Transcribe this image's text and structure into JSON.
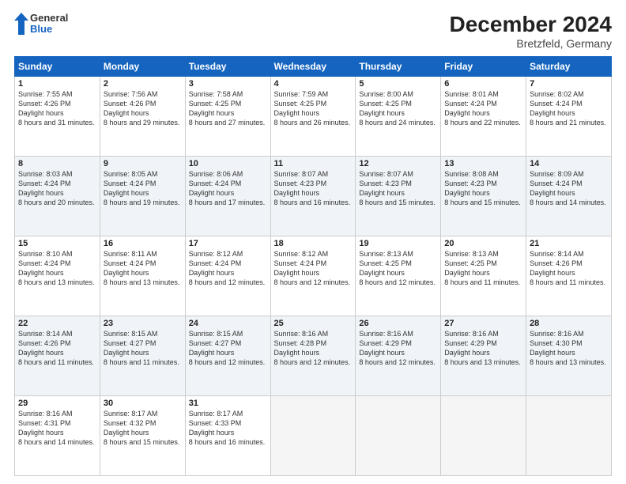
{
  "logo": {
    "general": "General",
    "blue": "Blue"
  },
  "title": "December 2024",
  "subtitle": "Bretzfeld, Germany",
  "days_of_week": [
    "Sunday",
    "Monday",
    "Tuesday",
    "Wednesday",
    "Thursday",
    "Friday",
    "Saturday"
  ],
  "weeks": [
    [
      {
        "day": "1",
        "sunrise": "7:55 AM",
        "sunset": "4:26 PM",
        "daylight": "8 hours and 31 minutes."
      },
      {
        "day": "2",
        "sunrise": "7:56 AM",
        "sunset": "4:26 PM",
        "daylight": "8 hours and 29 minutes."
      },
      {
        "day": "3",
        "sunrise": "7:58 AM",
        "sunset": "4:25 PM",
        "daylight": "8 hours and 27 minutes."
      },
      {
        "day": "4",
        "sunrise": "7:59 AM",
        "sunset": "4:25 PM",
        "daylight": "8 hours and 26 minutes."
      },
      {
        "day": "5",
        "sunrise": "8:00 AM",
        "sunset": "4:25 PM",
        "daylight": "8 hours and 24 minutes."
      },
      {
        "day": "6",
        "sunrise": "8:01 AM",
        "sunset": "4:24 PM",
        "daylight": "8 hours and 22 minutes."
      },
      {
        "day": "7",
        "sunrise": "8:02 AM",
        "sunset": "4:24 PM",
        "daylight": "8 hours and 21 minutes."
      }
    ],
    [
      {
        "day": "8",
        "sunrise": "8:03 AM",
        "sunset": "4:24 PM",
        "daylight": "8 hours and 20 minutes."
      },
      {
        "day": "9",
        "sunrise": "8:05 AM",
        "sunset": "4:24 PM",
        "daylight": "8 hours and 19 minutes."
      },
      {
        "day": "10",
        "sunrise": "8:06 AM",
        "sunset": "4:24 PM",
        "daylight": "8 hours and 17 minutes."
      },
      {
        "day": "11",
        "sunrise": "8:07 AM",
        "sunset": "4:23 PM",
        "daylight": "8 hours and 16 minutes."
      },
      {
        "day": "12",
        "sunrise": "8:07 AM",
        "sunset": "4:23 PM",
        "daylight": "8 hours and 15 minutes."
      },
      {
        "day": "13",
        "sunrise": "8:08 AM",
        "sunset": "4:23 PM",
        "daylight": "8 hours and 15 minutes."
      },
      {
        "day": "14",
        "sunrise": "8:09 AM",
        "sunset": "4:24 PM",
        "daylight": "8 hours and 14 minutes."
      }
    ],
    [
      {
        "day": "15",
        "sunrise": "8:10 AM",
        "sunset": "4:24 PM",
        "daylight": "8 hours and 13 minutes."
      },
      {
        "day": "16",
        "sunrise": "8:11 AM",
        "sunset": "4:24 PM",
        "daylight": "8 hours and 13 minutes."
      },
      {
        "day": "17",
        "sunrise": "8:12 AM",
        "sunset": "4:24 PM",
        "daylight": "8 hours and 12 minutes."
      },
      {
        "day": "18",
        "sunrise": "8:12 AM",
        "sunset": "4:24 PM",
        "daylight": "8 hours and 12 minutes."
      },
      {
        "day": "19",
        "sunrise": "8:13 AM",
        "sunset": "4:25 PM",
        "daylight": "8 hours and 12 minutes."
      },
      {
        "day": "20",
        "sunrise": "8:13 AM",
        "sunset": "4:25 PM",
        "daylight": "8 hours and 11 minutes."
      },
      {
        "day": "21",
        "sunrise": "8:14 AM",
        "sunset": "4:26 PM",
        "daylight": "8 hours and 11 minutes."
      }
    ],
    [
      {
        "day": "22",
        "sunrise": "8:14 AM",
        "sunset": "4:26 PM",
        "daylight": "8 hours and 11 minutes."
      },
      {
        "day": "23",
        "sunrise": "8:15 AM",
        "sunset": "4:27 PM",
        "daylight": "8 hours and 11 minutes."
      },
      {
        "day": "24",
        "sunrise": "8:15 AM",
        "sunset": "4:27 PM",
        "daylight": "8 hours and 12 minutes."
      },
      {
        "day": "25",
        "sunrise": "8:16 AM",
        "sunset": "4:28 PM",
        "daylight": "8 hours and 12 minutes."
      },
      {
        "day": "26",
        "sunrise": "8:16 AM",
        "sunset": "4:29 PM",
        "daylight": "8 hours and 12 minutes."
      },
      {
        "day": "27",
        "sunrise": "8:16 AM",
        "sunset": "4:29 PM",
        "daylight": "8 hours and 13 minutes."
      },
      {
        "day": "28",
        "sunrise": "8:16 AM",
        "sunset": "4:30 PM",
        "daylight": "8 hours and 13 minutes."
      }
    ],
    [
      {
        "day": "29",
        "sunrise": "8:16 AM",
        "sunset": "4:31 PM",
        "daylight": "8 hours and 14 minutes."
      },
      {
        "day": "30",
        "sunrise": "8:17 AM",
        "sunset": "4:32 PM",
        "daylight": "8 hours and 15 minutes."
      },
      {
        "day": "31",
        "sunrise": "8:17 AM",
        "sunset": "4:33 PM",
        "daylight": "8 hours and 16 minutes."
      },
      null,
      null,
      null,
      null
    ]
  ]
}
